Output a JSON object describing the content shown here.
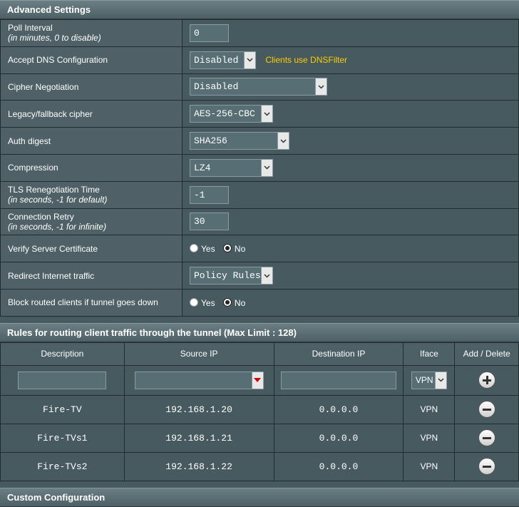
{
  "advanced": {
    "title": "Advanced Settings",
    "poll_interval": {
      "label": "Poll Interval",
      "hint": "(in minutes, 0 to disable)",
      "value": "0"
    },
    "accept_dns": {
      "label": "Accept DNS Configuration",
      "value": "Disabled",
      "note": "Clients use DNSFilter"
    },
    "cipher_negotiation": {
      "label": "Cipher Negotiation",
      "value": "Disabled"
    },
    "legacy_cipher": {
      "label": "Legacy/fallback cipher",
      "value": "AES-256-CBC"
    },
    "auth_digest": {
      "label": "Auth digest",
      "value": "SHA256"
    },
    "compression": {
      "label": "Compression",
      "value": "LZ4"
    },
    "tls_reneg": {
      "label": "TLS Renegotiation Time",
      "hint": "(in seconds, -1 for default)",
      "value": "-1"
    },
    "conn_retry": {
      "label": "Connection Retry",
      "hint": "(in seconds, -1 for infinite)",
      "value": "30"
    },
    "verify_cert": {
      "label": "Verify Server Certificate",
      "yes": "Yes",
      "no": "No",
      "selected": "No"
    },
    "redirect": {
      "label": "Redirect Internet traffic",
      "value": "Policy Rules"
    },
    "block_routed": {
      "label": "Block routed clients if tunnel goes down",
      "yes": "Yes",
      "no": "No",
      "selected": "No"
    }
  },
  "rules": {
    "title": "Rules for routing client traffic through the tunnel (Max Limit : 128)",
    "headers": {
      "description": "Description",
      "source_ip": "Source IP",
      "destination_ip": "Destination IP",
      "iface": "Iface",
      "add_delete": "Add / Delete"
    },
    "new_entry": {
      "iface": "VPN"
    },
    "rows": [
      {
        "description": "Fire-TV",
        "source_ip": "192.168.1.20",
        "destination_ip": "0.0.0.0",
        "iface": "VPN"
      },
      {
        "description": "Fire-TVs1",
        "source_ip": "192.168.1.21",
        "destination_ip": "0.0.0.0",
        "iface": "VPN"
      },
      {
        "description": "Fire-TVs2",
        "source_ip": "192.168.1.22",
        "destination_ip": "0.0.0.0",
        "iface": "VPN"
      }
    ]
  },
  "custom": {
    "title": "Custom Configuration"
  },
  "icons": {
    "dropdown": "chevron-down-icon",
    "dropdown_red": "red-triangle-down-icon",
    "add": "plus-circle-icon",
    "delete": "minus-circle-icon"
  },
  "colors": {
    "note": "#ffcc00",
    "dropdown_arrow_red": "#cc0000"
  }
}
